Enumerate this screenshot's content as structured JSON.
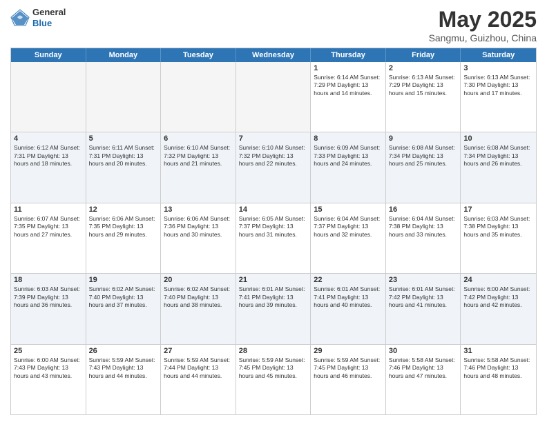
{
  "header": {
    "logo": {
      "general": "General",
      "blue": "Blue"
    },
    "title": "May 2025",
    "location": "Sangmu, Guizhou, China"
  },
  "days_of_week": [
    "Sunday",
    "Monday",
    "Tuesday",
    "Wednesday",
    "Thursday",
    "Friday",
    "Saturday"
  ],
  "rows": [
    {
      "alt": false,
      "cells": [
        {
          "day": "",
          "empty": true,
          "info": ""
        },
        {
          "day": "",
          "empty": true,
          "info": ""
        },
        {
          "day": "",
          "empty": true,
          "info": ""
        },
        {
          "day": "",
          "empty": true,
          "info": ""
        },
        {
          "day": "1",
          "empty": false,
          "info": "Sunrise: 6:14 AM\nSunset: 7:29 PM\nDaylight: 13 hours\nand 14 minutes."
        },
        {
          "day": "2",
          "empty": false,
          "info": "Sunrise: 6:13 AM\nSunset: 7:29 PM\nDaylight: 13 hours\nand 15 minutes."
        },
        {
          "day": "3",
          "empty": false,
          "info": "Sunrise: 6:13 AM\nSunset: 7:30 PM\nDaylight: 13 hours\nand 17 minutes."
        }
      ]
    },
    {
      "alt": true,
      "cells": [
        {
          "day": "4",
          "empty": false,
          "info": "Sunrise: 6:12 AM\nSunset: 7:31 PM\nDaylight: 13 hours\nand 18 minutes."
        },
        {
          "day": "5",
          "empty": false,
          "info": "Sunrise: 6:11 AM\nSunset: 7:31 PM\nDaylight: 13 hours\nand 20 minutes."
        },
        {
          "day": "6",
          "empty": false,
          "info": "Sunrise: 6:10 AM\nSunset: 7:32 PM\nDaylight: 13 hours\nand 21 minutes."
        },
        {
          "day": "7",
          "empty": false,
          "info": "Sunrise: 6:10 AM\nSunset: 7:32 PM\nDaylight: 13 hours\nand 22 minutes."
        },
        {
          "day": "8",
          "empty": false,
          "info": "Sunrise: 6:09 AM\nSunset: 7:33 PM\nDaylight: 13 hours\nand 24 minutes."
        },
        {
          "day": "9",
          "empty": false,
          "info": "Sunrise: 6:08 AM\nSunset: 7:34 PM\nDaylight: 13 hours\nand 25 minutes."
        },
        {
          "day": "10",
          "empty": false,
          "info": "Sunrise: 6:08 AM\nSunset: 7:34 PM\nDaylight: 13 hours\nand 26 minutes."
        }
      ]
    },
    {
      "alt": false,
      "cells": [
        {
          "day": "11",
          "empty": false,
          "info": "Sunrise: 6:07 AM\nSunset: 7:35 PM\nDaylight: 13 hours\nand 27 minutes."
        },
        {
          "day": "12",
          "empty": false,
          "info": "Sunrise: 6:06 AM\nSunset: 7:35 PM\nDaylight: 13 hours\nand 29 minutes."
        },
        {
          "day": "13",
          "empty": false,
          "info": "Sunrise: 6:06 AM\nSunset: 7:36 PM\nDaylight: 13 hours\nand 30 minutes."
        },
        {
          "day": "14",
          "empty": false,
          "info": "Sunrise: 6:05 AM\nSunset: 7:37 PM\nDaylight: 13 hours\nand 31 minutes."
        },
        {
          "day": "15",
          "empty": false,
          "info": "Sunrise: 6:04 AM\nSunset: 7:37 PM\nDaylight: 13 hours\nand 32 minutes."
        },
        {
          "day": "16",
          "empty": false,
          "info": "Sunrise: 6:04 AM\nSunset: 7:38 PM\nDaylight: 13 hours\nand 33 minutes."
        },
        {
          "day": "17",
          "empty": false,
          "info": "Sunrise: 6:03 AM\nSunset: 7:38 PM\nDaylight: 13 hours\nand 35 minutes."
        }
      ]
    },
    {
      "alt": true,
      "cells": [
        {
          "day": "18",
          "empty": false,
          "info": "Sunrise: 6:03 AM\nSunset: 7:39 PM\nDaylight: 13 hours\nand 36 minutes."
        },
        {
          "day": "19",
          "empty": false,
          "info": "Sunrise: 6:02 AM\nSunset: 7:40 PM\nDaylight: 13 hours\nand 37 minutes."
        },
        {
          "day": "20",
          "empty": false,
          "info": "Sunrise: 6:02 AM\nSunset: 7:40 PM\nDaylight: 13 hours\nand 38 minutes."
        },
        {
          "day": "21",
          "empty": false,
          "info": "Sunrise: 6:01 AM\nSunset: 7:41 PM\nDaylight: 13 hours\nand 39 minutes."
        },
        {
          "day": "22",
          "empty": false,
          "info": "Sunrise: 6:01 AM\nSunset: 7:41 PM\nDaylight: 13 hours\nand 40 minutes."
        },
        {
          "day": "23",
          "empty": false,
          "info": "Sunrise: 6:01 AM\nSunset: 7:42 PM\nDaylight: 13 hours\nand 41 minutes."
        },
        {
          "day": "24",
          "empty": false,
          "info": "Sunrise: 6:00 AM\nSunset: 7:42 PM\nDaylight: 13 hours\nand 42 minutes."
        }
      ]
    },
    {
      "alt": false,
      "cells": [
        {
          "day": "25",
          "empty": false,
          "info": "Sunrise: 6:00 AM\nSunset: 7:43 PM\nDaylight: 13 hours\nand 43 minutes."
        },
        {
          "day": "26",
          "empty": false,
          "info": "Sunrise: 5:59 AM\nSunset: 7:43 PM\nDaylight: 13 hours\nand 44 minutes."
        },
        {
          "day": "27",
          "empty": false,
          "info": "Sunrise: 5:59 AM\nSunset: 7:44 PM\nDaylight: 13 hours\nand 44 minutes."
        },
        {
          "day": "28",
          "empty": false,
          "info": "Sunrise: 5:59 AM\nSunset: 7:45 PM\nDaylight: 13 hours\nand 45 minutes."
        },
        {
          "day": "29",
          "empty": false,
          "info": "Sunrise: 5:59 AM\nSunset: 7:45 PM\nDaylight: 13 hours\nand 46 minutes."
        },
        {
          "day": "30",
          "empty": false,
          "info": "Sunrise: 5:58 AM\nSunset: 7:46 PM\nDaylight: 13 hours\nand 47 minutes."
        },
        {
          "day": "31",
          "empty": false,
          "info": "Sunrise: 5:58 AM\nSunset: 7:46 PM\nDaylight: 13 hours\nand 48 minutes."
        }
      ]
    }
  ]
}
